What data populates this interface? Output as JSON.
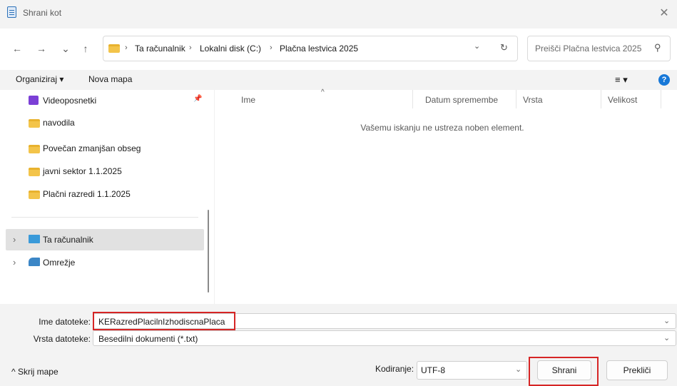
{
  "window": {
    "title": "Shrani kot",
    "close_symbol": "✕"
  },
  "nav": {
    "back": "←",
    "forward": "→",
    "recent": "⌄",
    "up": "↑",
    "breadcrumbs": [
      "Ta računalnik",
      "Lokalni disk (C:)",
      "Plačna lestvica 2025"
    ],
    "separator": "›",
    "address_dropdown": "⌄",
    "refresh": "↻",
    "search_placeholder": "Preišči Plačna lestvica 2025",
    "search_icon": "⚲"
  },
  "toolbar": {
    "organize": "Organiziraj ▾",
    "new_folder": "Nova mapa",
    "view_menu": "≡ ▾",
    "help": "?"
  },
  "sidebar": {
    "items": [
      {
        "label": "Videoposnetki",
        "icon": "video-icon",
        "pinned": "📌"
      },
      {
        "label": "navodila",
        "icon": "folder-icon"
      },
      {
        "label": "Povečan zmanjšan obseg",
        "icon": "folder-icon"
      },
      {
        "label": "javni sektor 1.1.2025",
        "icon": "folder-icon"
      },
      {
        "label": "Plačni razredi 1.1.2025",
        "icon": "folder-icon"
      }
    ],
    "tree": [
      {
        "label": "Ta računalnik",
        "icon": "computer-icon",
        "chevron": "›"
      },
      {
        "label": "Omrežje",
        "icon": "network-icon",
        "chevron": "›"
      }
    ]
  },
  "columns": {
    "headers": [
      "Ime",
      "Datum spremembe",
      "Vrsta",
      "Velikost"
    ],
    "sort_indicator": "^",
    "empty_message": "Vašemu iskanju ne ustreza noben element."
  },
  "form": {
    "filename_label": "Ime datoteke:",
    "filename_value": "KERazredPlacilnIzhodiscnaPlaca",
    "filetype_label": "Vrsta datoteke:",
    "filetype_value": "Besedilni dokumenti (*.txt)",
    "dropdown": "⌄"
  },
  "footer": {
    "hide_folders": "^ Skrij mape",
    "encoding_label": "Kodiranje:",
    "encoding_value": "UTF-8",
    "encoding_dropdown": "⌄",
    "save": "Shrani",
    "cancel": "Prekliči"
  },
  "colors": {
    "highlight": "#d62525",
    "accent": "#1778d8",
    "folder": "#f3c44a"
  }
}
